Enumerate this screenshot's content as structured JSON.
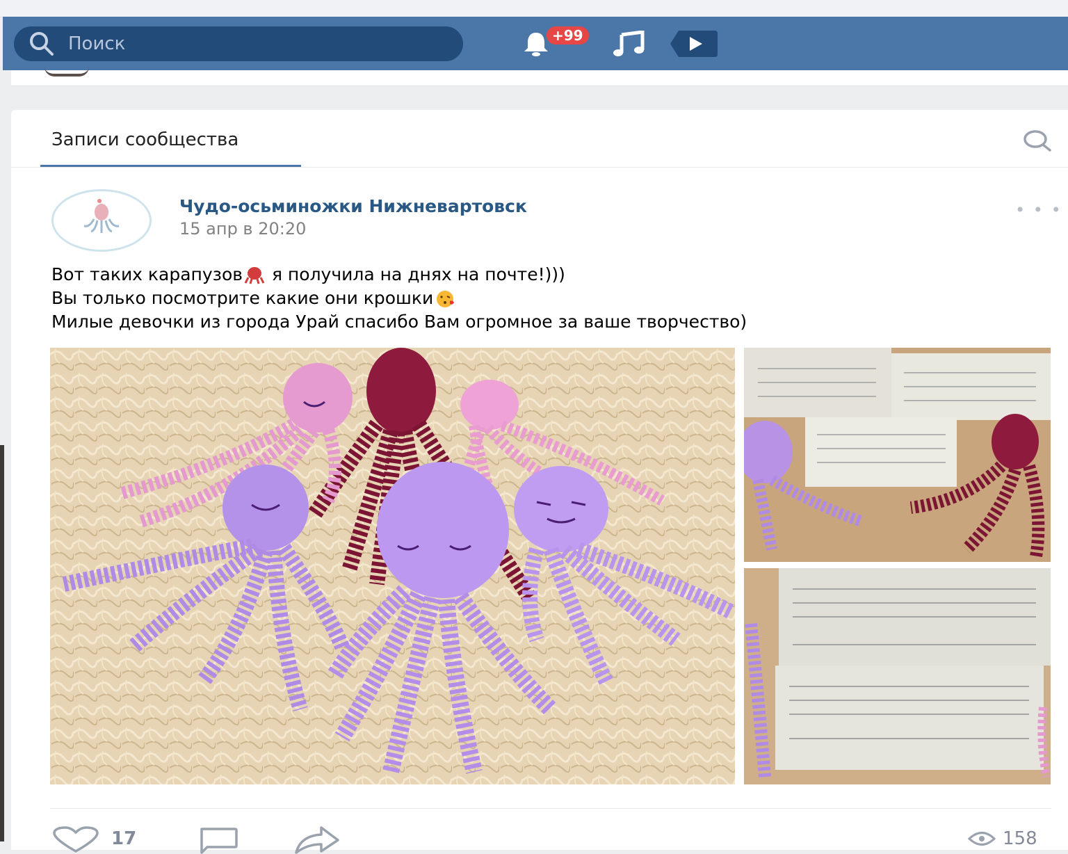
{
  "header": {
    "search_placeholder": "Поиск",
    "notifications_badge": "+99",
    "icons": [
      "search-icon",
      "bell-icon",
      "music-icon",
      "video-icon"
    ]
  },
  "tabs": {
    "active": "Записи сообщества"
  },
  "post": {
    "author": "Чудо-осьминожки Нижневартовск",
    "date": "15 апр в 20:20",
    "lines": [
      "Вот таких карапузов",
      " я получила на днях на почте!)))",
      "Вы только посмотрите какие они крошки",
      "Милые девочки из города Урай спасибо Вам огромное за ваше творчество)"
    ],
    "likes": "17",
    "views": "158"
  },
  "colors": {
    "header": "#4a76a8",
    "search_bg": "#224b7a",
    "link": "#2a5885",
    "badge": "#e64646"
  }
}
